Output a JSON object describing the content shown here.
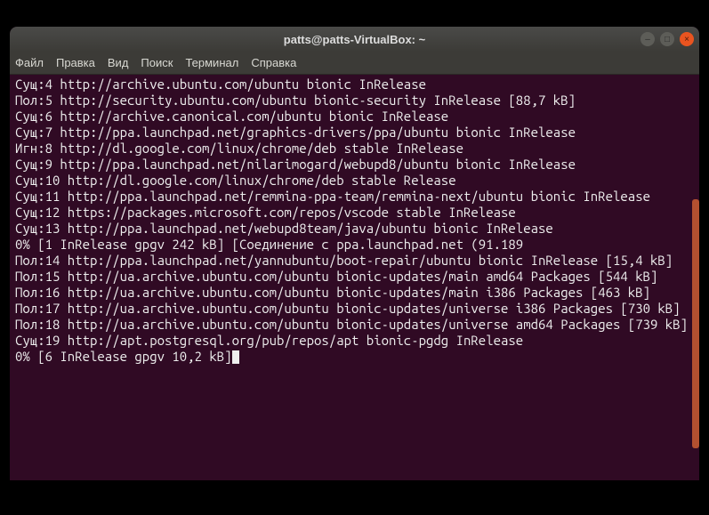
{
  "window": {
    "title": "patts@patts-VirtualBox: ~"
  },
  "menu": {
    "file": "Файл",
    "edit": "Правка",
    "view": "Вид",
    "search": "Поиск",
    "terminal": "Терминал",
    "help": "Справка"
  },
  "lines": [
    "Сущ:4 http://archive.ubuntu.com/ubuntu bionic InRelease",
    "Пол:5 http://security.ubuntu.com/ubuntu bionic-security InRelease [88,7 kB]",
    "Сущ:6 http://archive.canonical.com/ubuntu bionic InRelease",
    "Сущ:7 http://ppa.launchpad.net/graphics-drivers/ppa/ubuntu bionic InRelease",
    "Игн:8 http://dl.google.com/linux/chrome/deb stable InRelease",
    "Сущ:9 http://ppa.launchpad.net/nilarimogard/webupd8/ubuntu bionic InRelease",
    "Сущ:10 http://dl.google.com/linux/chrome/deb stable Release",
    "Сущ:11 http://ppa.launchpad.net/remmina-ppa-team/remmina-next/ubuntu bionic InRelease",
    "Сущ:12 https://packages.microsoft.com/repos/vscode stable InRelease",
    "Сущ:13 http://ppa.launchpad.net/webupd8team/java/ubuntu bionic InRelease",
    "0% [1 InRelease gpgv 242 kB] [Соединение с ppa.launchpad.net (91.189",
    "Пол:14 http://ppa.launchpad.net/yannubuntu/boot-repair/ubuntu bionic InRelease [15,4 kB]",
    "Пол:15 http://ua.archive.ubuntu.com/ubuntu bionic-updates/main amd64 Packages [544 kB]",
    "Пол:16 http://ua.archive.ubuntu.com/ubuntu bionic-updates/main i386 Packages [463 kB]",
    "Пол:17 http://ua.archive.ubuntu.com/ubuntu bionic-updates/universe i386 Packages [730 kB]",
    "Пол:18 http://ua.archive.ubuntu.com/ubuntu bionic-updates/universe amd64 Packages [739 kB]",
    "Сущ:19 http://apt.postgresql.org/pub/repos/apt bionic-pgdg InRelease",
    "0% [6 InRelease gpgv 10,2 kB]"
  ]
}
